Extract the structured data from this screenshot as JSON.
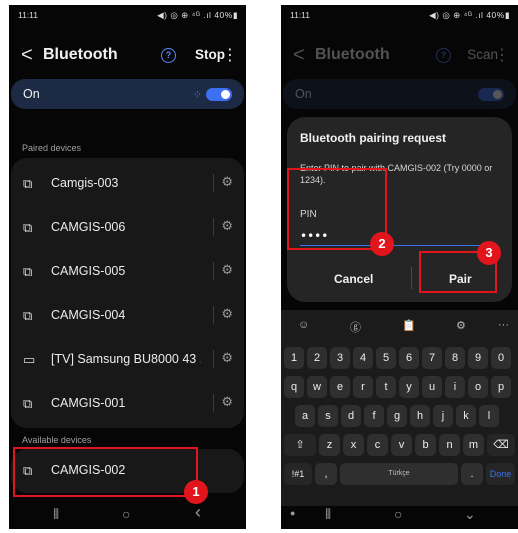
{
  "left": {
    "status": {
      "time": "11:11",
      "icons": "◀) ◎ ⊕ ⁴ᴳ .ıl 40%▮"
    },
    "header": {
      "back": "<",
      "title": "Bluetooth",
      "help": "?",
      "stop_label": "Stop",
      "menu": "⋮"
    },
    "toggle_row": {
      "label": "On",
      "dots": "⁘"
    },
    "paired_label": "Paired devices",
    "paired": [
      {
        "name": "Camgis-003",
        "icon": "⧉"
      },
      {
        "name": "CAMGIS-006",
        "icon": "⧉"
      },
      {
        "name": "CAMGIS-005",
        "icon": "⧉"
      },
      {
        "name": "CAMGIS-004",
        "icon": "⧉"
      },
      {
        "name": "[TV] Samsung BU8000 43 ...",
        "icon": "▭"
      },
      {
        "name": "CAMGIS-001",
        "icon": "⧉"
      }
    ],
    "gear": "⚙",
    "available_label": "Available devices",
    "available": [
      {
        "name": "CAMGIS-002",
        "icon": "⧉"
      }
    ],
    "nav": {
      "recent": "⦀",
      "home": "○",
      "back": "‹"
    },
    "badge": "1"
  },
  "right": {
    "status": {
      "time": "11:11",
      "icons": "◀) ◎ ⊕ ⁴ᴳ .ıl 40%▮"
    },
    "header": {
      "back": "<",
      "title": "Bluetooth",
      "help": "?",
      "scan_label": "Scan",
      "menu": "⋮"
    },
    "toggle_row": {
      "label": "On"
    },
    "dialog": {
      "title": "Bluetooth pairing request",
      "message": "Enter PIN to pair with CAMGIS-002 (Try 0000 or 1234).",
      "pin_label": "PIN",
      "pin_value": "••••",
      "cancel": "Cancel",
      "pair": "Pair"
    },
    "keyboard": {
      "toolbar": [
        "☺",
        "ⓖ",
        "📋",
        "⚙",
        "···"
      ],
      "row1": [
        "1",
        "2",
        "3",
        "4",
        "5",
        "6",
        "7",
        "8",
        "9",
        "0"
      ],
      "row2": [
        "q",
        "w",
        "e",
        "r",
        "t",
        "y",
        "u",
        "i",
        "o",
        "p"
      ],
      "row3": [
        "a",
        "s",
        "d",
        "f",
        "g",
        "h",
        "j",
        "k",
        "l"
      ],
      "shift": "⇧",
      "row4": [
        "z",
        "x",
        "c",
        "v",
        "b",
        "n",
        "m"
      ],
      "backspace": "⌫",
      "symbols": "!#1",
      "comma": ",",
      "space": "Türkçe",
      "period": ".",
      "done": "Done"
    },
    "nav": {
      "mic": "●",
      "recent": "⦀",
      "home": "○",
      "hide": "⌄"
    },
    "badges": [
      "2",
      "3"
    ]
  }
}
